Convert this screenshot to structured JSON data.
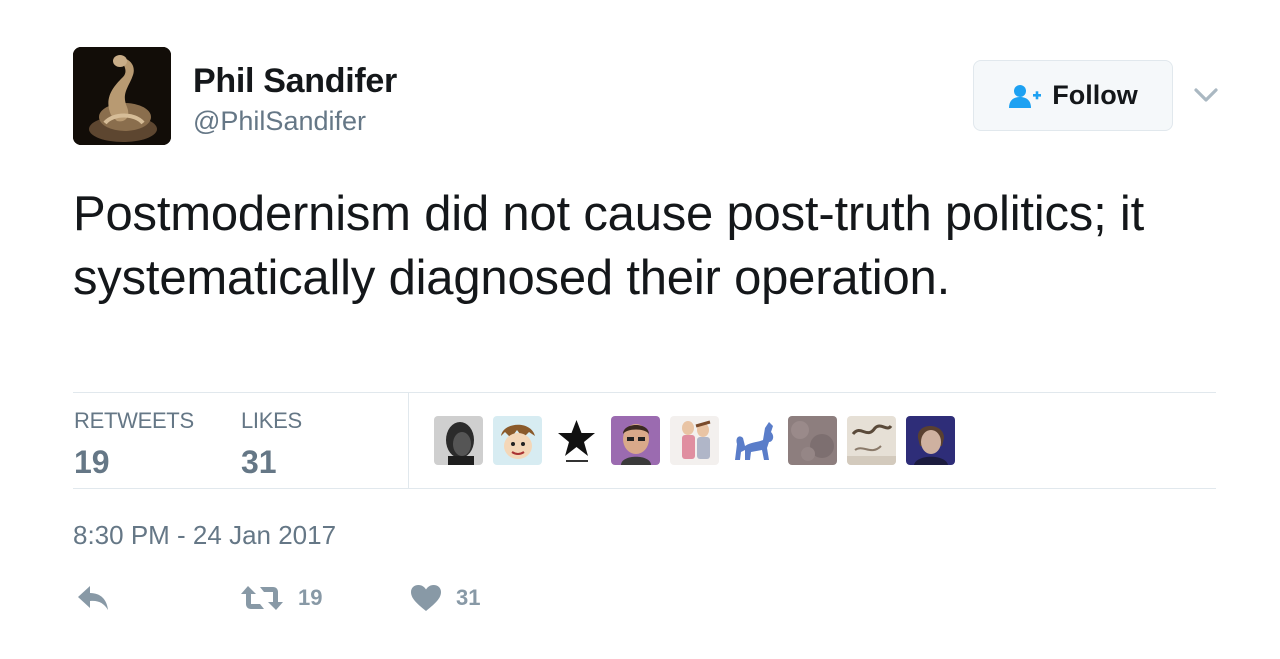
{
  "author": {
    "name": "Phil Sandifer",
    "handle": "@PhilSandifer",
    "avatar_icon": "avatar-photo"
  },
  "follow_button": {
    "label": "Follow",
    "icon": "add-user-icon",
    "accent": "#1da1f2"
  },
  "tweet": {
    "text": "Postmodernism did not cause post-truth politics; it systematically diagnosed their operation."
  },
  "stats": {
    "retweets": {
      "label": "RETWEETS",
      "value": "19"
    },
    "likes": {
      "label": "LIKES",
      "value": "31"
    }
  },
  "likers": [
    {
      "icon": "liker-avatar-1"
    },
    {
      "icon": "liker-avatar-2"
    },
    {
      "icon": "liker-avatar-3-star"
    },
    {
      "icon": "liker-avatar-4"
    },
    {
      "icon": "liker-avatar-5"
    },
    {
      "icon": "liker-avatar-6-pony"
    },
    {
      "icon": "liker-avatar-7"
    },
    {
      "icon": "liker-avatar-8"
    },
    {
      "icon": "liker-avatar-9"
    }
  ],
  "timestamp": "8:30 PM - 24 Jan 2017",
  "actions": {
    "reply": {
      "icon": "reply-icon"
    },
    "retweet": {
      "icon": "retweet-icon",
      "count": "19"
    },
    "like": {
      "icon": "heart-icon",
      "count": "31"
    }
  },
  "colors": {
    "text": "#14171a",
    "muted": "#657786",
    "action_gray": "#8899a6",
    "divider": "#e1e8ed"
  }
}
